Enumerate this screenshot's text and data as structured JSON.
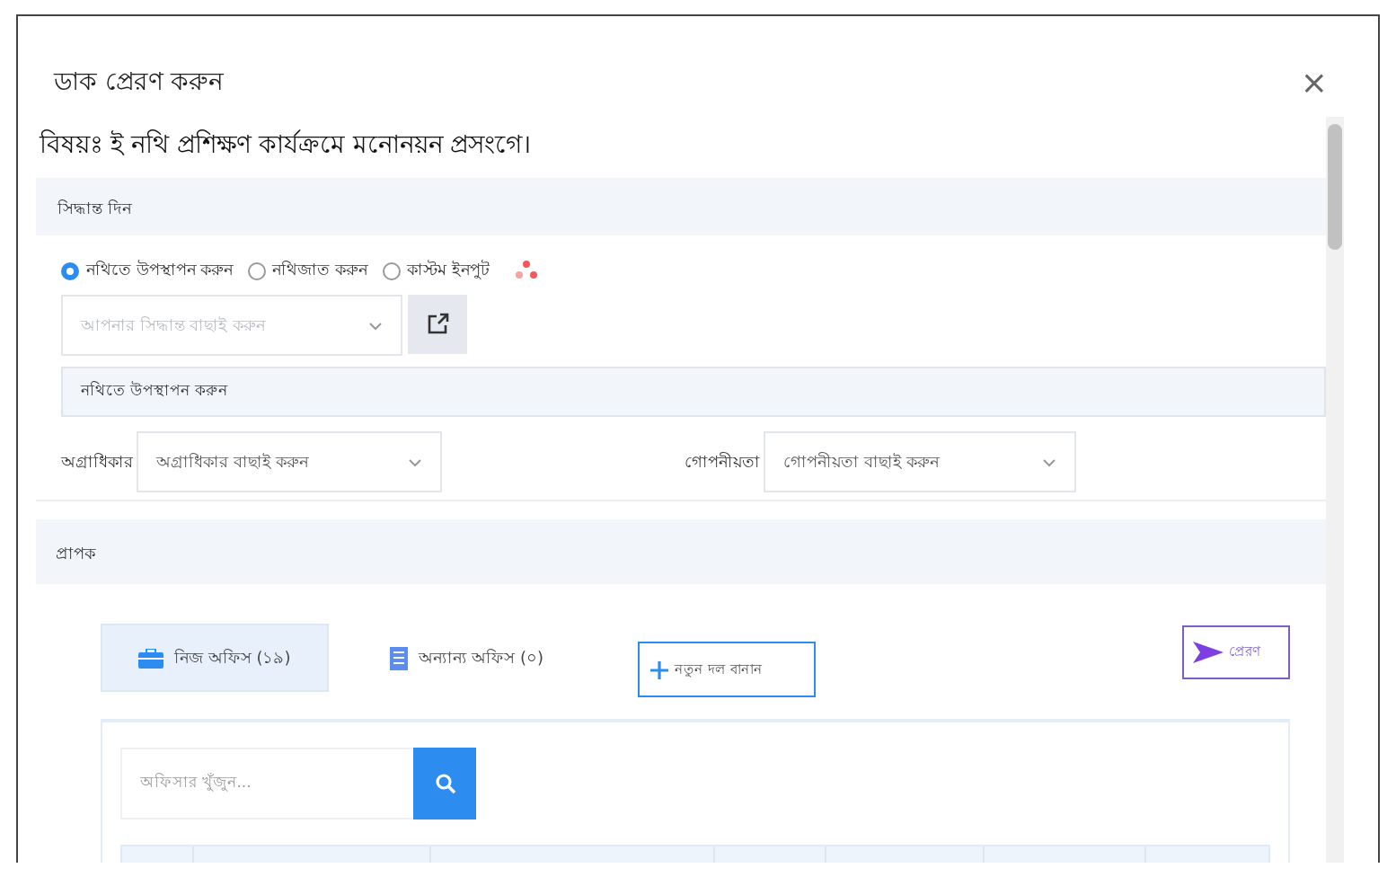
{
  "dialog": {
    "title": "ডাক প্রেরণ করুন",
    "close": "×"
  },
  "subject": "বিষয়ঃ ই নথি প্রশিক্ষণ কার্যক্রমে মনোনয়ন প্রসংগে।",
  "decision": {
    "heading": "সিদ্ধান্ত দিন",
    "options": [
      {
        "label": "নথিতে উপস্থাপন করুন",
        "selected": true
      },
      {
        "label": "নথিজাত করুন",
        "selected": false
      },
      {
        "label": "কাস্টম ইনপুট",
        "selected": false
      }
    ],
    "select": {
      "placeholder": "আপনার সিদ্ধান্ত বাছাই করুন"
    },
    "note": "নথিতে উপস্থাপন করুন"
  },
  "priority": {
    "label": "অগ্রাধিকার",
    "placeholder": "অগ্রাধিকার বাছাই করুন"
  },
  "secrecy": {
    "label": "গোপনীয়তা",
    "placeholder": "গোপনীয়তা বাছাই করুন"
  },
  "recipient": {
    "heading": "প্রাপক",
    "tabs": [
      {
        "label": "নিজ অফিস (১৯)",
        "selected": true,
        "kind": "briefcase"
      },
      {
        "label": "অন্যান্য অফিস (০)",
        "selected": false,
        "kind": "building"
      }
    ],
    "new_group_button": "নতুন দল বানান",
    "send_button": "প্রেরণ",
    "search": {
      "placeholder": "অফিসার খুঁজুন..."
    }
  }
}
